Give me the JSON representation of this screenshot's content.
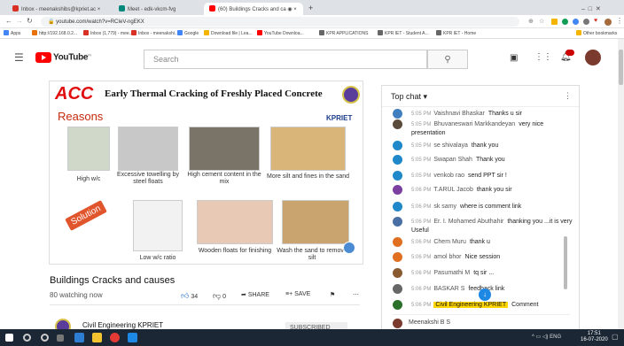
{
  "browser": {
    "tabs": [
      {
        "label": "Inbox - meenakshibs@kpriet.ac ×",
        "color": "#d93025"
      },
      {
        "label": "Meet - edk-vkcm-fvg",
        "color": "#00897b"
      },
      {
        "label": "(60) Buildings Cracks and ca ◉ ×",
        "color": "#ff0000"
      }
    ],
    "new_tab": "+",
    "url": "youtube.com/watch?v=RCIeV-ngEKX",
    "bookmarks": [
      "Apps",
      "http://192.168.0.2...",
      "Inbox (1,779) - mee...",
      "Inbox - meenakshi...",
      "Google",
      "Download file | Lea...",
      "YouTube Downloa...",
      "KPR APPLICATIONS",
      "KPR IET - Student A...",
      "KPR IET - Home",
      "Other bookmarks"
    ]
  },
  "youtube": {
    "logo": "YouTube",
    "logo_sup": "IN",
    "search_placeholder": "Search"
  },
  "slide": {
    "brand": "ACC",
    "title": "Early Thermal Cracking of Freshly Placed Concrete",
    "org": "KPRIET",
    "reasons": "Reasons",
    "solution": "Solution",
    "row1": [
      "High w/c",
      "Excessive towelling by steel floats",
      "High cement content in the mix",
      "More silt and fines in the sand"
    ],
    "row2": [
      "Low w/c ratio",
      "Wooden floats for finishing",
      "Wash the sand to remove silt"
    ]
  },
  "video": {
    "title": "Buildings Cracks and causes",
    "watching": "80 watching now",
    "likes": "34",
    "dislikes": "0",
    "share": "SHARE",
    "save": "SAVE",
    "channel": "Civil Engineering KPRIET",
    "subscribe": "SUBSCRIBED"
  },
  "chat": {
    "header": "Top chat",
    "messages": [
      {
        "time": "5:05 PM",
        "author": "Vaishnavi Bhaskar",
        "text": "Thanks u sir",
        "color": "#3f7fbf"
      },
      {
        "time": "5:05 PM",
        "author": "Bhuvaneswari Markkandeyan",
        "text": "very nice presentation",
        "color": "#5a4a3a"
      },
      {
        "time": "5:05 PM",
        "author": "se shivalaya",
        "text": "thank you",
        "color": "#1e88c8"
      },
      {
        "time": "5:05 PM",
        "author": "Swapan Shah",
        "text": "Thank you",
        "color": "#1e88c8"
      },
      {
        "time": "5:05 PM",
        "author": "venkob rao",
        "text": "send PPT sir !",
        "color": "#1e88c8"
      },
      {
        "time": "5:06 PM",
        "author": "T.ARUL Jacob",
        "text": "thank you sir",
        "color": "#7b3fa0"
      },
      {
        "time": "5:06 PM",
        "author": "sk samy",
        "text": "where is comment link",
        "color": "#1e88c8"
      },
      {
        "time": "5:06 PM",
        "author": "Er. I. Mohamed Abuthahir",
        "text": "thanking you ...it is very Useful",
        "color": "#4a6fa5"
      },
      {
        "time": "5:06 PM",
        "author": "Chem Muru",
        "text": "thank u",
        "color": "#e07020"
      },
      {
        "time": "5:06 PM",
        "author": "amol bhor",
        "text": "Nice session",
        "color": "#e07020"
      },
      {
        "time": "5:06 PM",
        "author": "Pasumathi M",
        "text": "tq sir ...",
        "color": "#8a5a30"
      },
      {
        "time": "5:06 PM",
        "author": "BASKAR S",
        "text": "feedback link",
        "color": "#666666"
      },
      {
        "time": "5:06 PM",
        "author": "Civil Engineering KPRIET",
        "text": "Comment",
        "color": "#2a6f2a"
      }
    ],
    "input_user": "Meenakshi B S"
  },
  "taskbar": {
    "time": "17:51",
    "date": "16-07-2020",
    "lang": "ENG"
  }
}
